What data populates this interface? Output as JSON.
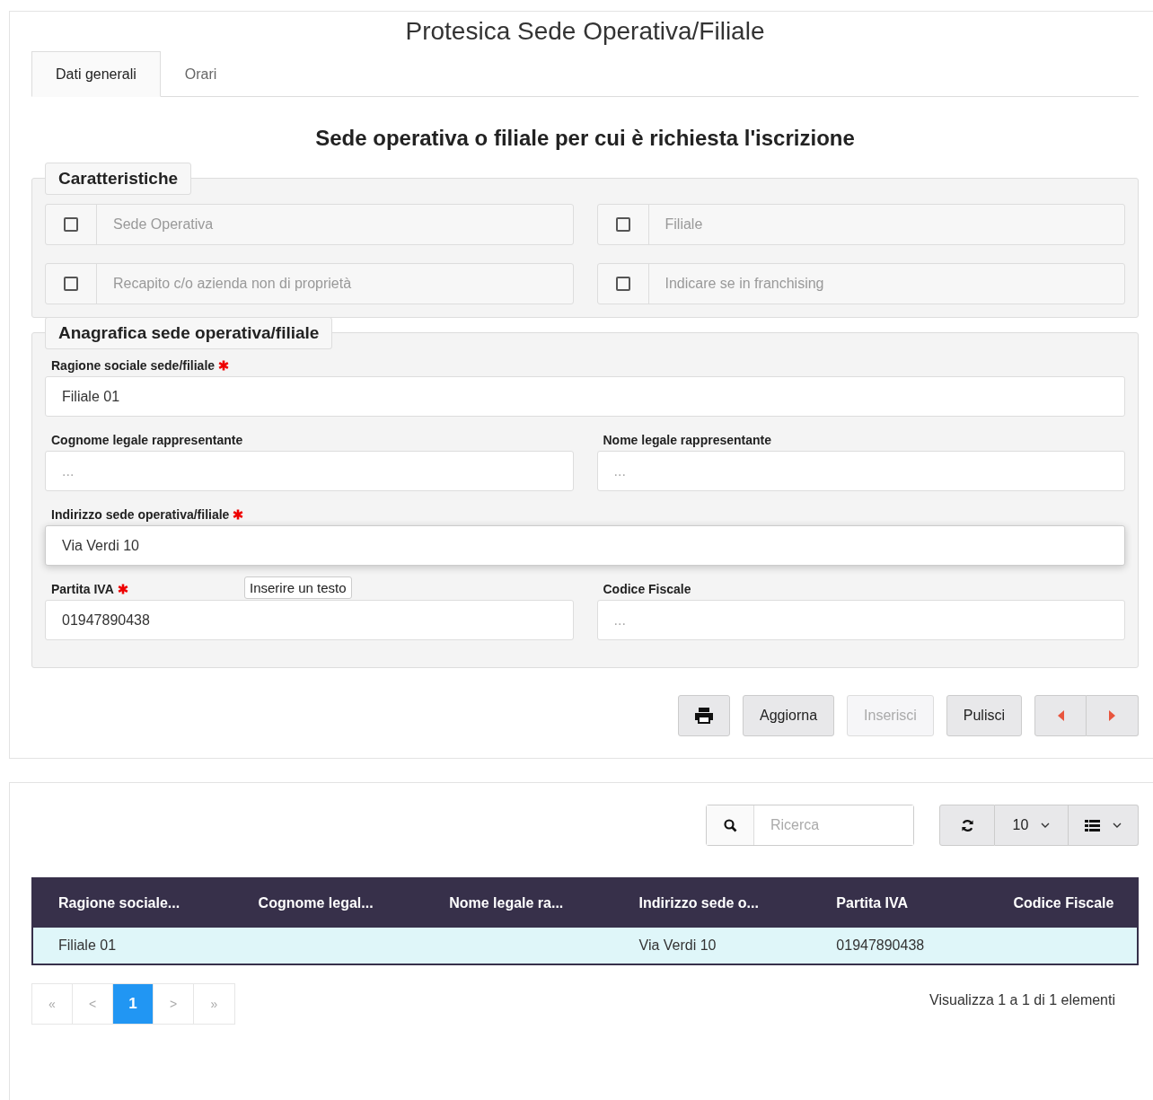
{
  "title": "Protesica Sede Operativa/Filiale",
  "tabs": [
    {
      "label": "Dati generali",
      "selected": true
    },
    {
      "label": "Orari",
      "selected": false
    }
  ],
  "heading": "Sede operativa o filiale per cui è richiesta l'iscrizione",
  "characteristics": {
    "legend": "Caratteristiche",
    "options": [
      {
        "label": "Sede Operativa",
        "checked": false
      },
      {
        "label": "Filiale",
        "checked": false
      },
      {
        "label": "Recapito c/o azienda non di proprietà",
        "checked": false
      },
      {
        "label": "Indicare se in franchising",
        "checked": false
      }
    ]
  },
  "registry": {
    "legend": "Anagrafica sede operativa/filiale",
    "rows": [
      {
        "fields": [
          {
            "label": "Ragione sociale sede/filiale",
            "required": true,
            "value": "Filiale 01",
            "focused": false
          }
        ]
      },
      {
        "fields": [
          {
            "label": "Cognome legale rappresentante",
            "required": false,
            "placeholder": "...",
            "focused": false
          },
          {
            "label": "Nome legale rappresentante",
            "required": false,
            "placeholder": "...",
            "focused": false
          }
        ]
      },
      {
        "fields": [
          {
            "label": "Indirizzo sede operativa/filiale",
            "required": true,
            "value": "Via Verdi 10",
            "focused": true
          }
        ]
      },
      {
        "fields": [
          {
            "label": "Partita IVA",
            "required": true,
            "value": "01947890438",
            "focused": false,
            "tooltip": "Inserire un testo"
          },
          {
            "label": "Codice Fiscale",
            "required": false,
            "placeholder": "...",
            "focused": false
          }
        ]
      }
    ]
  },
  "actions": [
    {
      "kind": "print",
      "disabled": false
    },
    {
      "kind": "text",
      "label": "Aggiorna",
      "disabled": false
    },
    {
      "kind": "text",
      "label": "Inserisci",
      "disabled": true
    },
    {
      "kind": "text",
      "label": "Pulisci",
      "disabled": false
    },
    {
      "kind": "prev",
      "disabled": false
    },
    {
      "kind": "next",
      "disabled": false
    }
  ],
  "table_toolbar": {
    "search": {
      "placeholder": "Ricerca"
    },
    "page_size": "10"
  },
  "table": {
    "columns": [
      "Ragione sociale...",
      "Cognome legal...",
      "Nome legale ra...",
      "Indirizzo sede o...",
      "Partita IVA",
      "Codice Fiscale"
    ],
    "rows": [
      {
        "selected": true,
        "cells": [
          "Filiale 01",
          "",
          "",
          "Via Verdi 10",
          "01947890438",
          ""
        ]
      }
    ]
  },
  "pagination": {
    "pages": [
      {
        "label": "«",
        "selected": false
      },
      {
        "label": "<",
        "selected": false
      },
      {
        "label": "1",
        "selected": true
      },
      {
        "label": ">",
        "selected": false
      },
      {
        "label": "»",
        "selected": false
      }
    ],
    "summary": "Visualizza 1 a 1 di 1 elementi"
  }
}
